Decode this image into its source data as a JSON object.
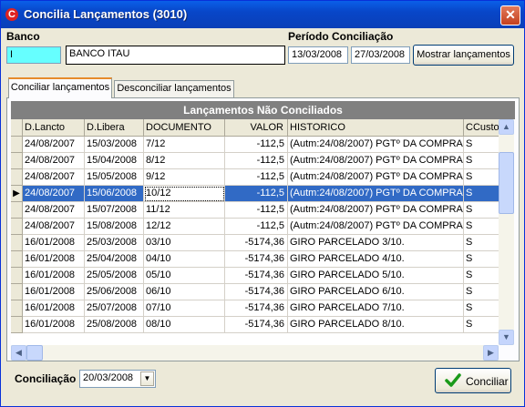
{
  "window": {
    "title": "Concilia Lançamentos (3010)",
    "close": "✕"
  },
  "banco": {
    "label": "Banco",
    "code": "I",
    "name": "BANCO ITAU"
  },
  "periodo": {
    "label": "Período Conciliação",
    "start": "13/03/2008",
    "end": "27/03/2008",
    "button": "Mostrar lançamentos"
  },
  "tabs": [
    "Conciliar lançamentos",
    "Desconciliar lançamentos"
  ],
  "grid": {
    "title": "Lançamentos Não Conciliados",
    "columns": [
      "D.Lancto",
      "D.Libera",
      "DOCUMENTO",
      "VALOR",
      "HISTORICO",
      "CCusto"
    ],
    "selected_row": 3,
    "current_marker": "▶",
    "rows": [
      [
        "24/08/2007",
        "15/03/2008",
        "7/12",
        "-112,5",
        "(Autm:24/08/2007) PGTº DA COMPRA",
        "S"
      ],
      [
        "24/08/2007",
        "15/04/2008",
        "8/12",
        "-112,5",
        "(Autm:24/08/2007) PGTº DA COMPRA",
        "S"
      ],
      [
        "24/08/2007",
        "15/05/2008",
        "9/12",
        "-112,5",
        "(Autm:24/08/2007) PGTº DA COMPRA",
        "S"
      ],
      [
        "24/08/2007",
        "15/06/2008",
        "10/12",
        "-112,5",
        "(Autm:24/08/2007) PGTº DA COMPRA",
        "S"
      ],
      [
        "24/08/2007",
        "15/07/2008",
        "11/12",
        "-112,5",
        "(Autm:24/08/2007) PGTº DA COMPRA",
        "S"
      ],
      [
        "24/08/2007",
        "15/08/2008",
        "12/12",
        "-112,5",
        "(Autm:24/08/2007) PGTº DA COMPRA",
        "S"
      ],
      [
        "16/01/2008",
        "25/03/2008",
        "03/10",
        "-5174,36",
        "GIRO PARCELADO 3/10.",
        "S"
      ],
      [
        "16/01/2008",
        "25/04/2008",
        "04/10",
        "-5174,36",
        "GIRO PARCELADO 4/10.",
        "S"
      ],
      [
        "16/01/2008",
        "25/05/2008",
        "05/10",
        "-5174,36",
        "GIRO PARCELADO 5/10.",
        "S"
      ],
      [
        "16/01/2008",
        "25/06/2008",
        "06/10",
        "-5174,36",
        "GIRO PARCELADO 6/10.",
        "S"
      ],
      [
        "16/01/2008",
        "25/07/2008",
        "07/10",
        "-5174,36",
        "GIRO PARCELADO 7/10.",
        "S"
      ],
      [
        "16/01/2008",
        "25/08/2008",
        "08/10",
        "-5174,36",
        "GIRO PARCELADO 8/10.",
        "S"
      ]
    ]
  },
  "conciliacao": {
    "label": "Conciliação",
    "date": "20/03/2008",
    "button": "Conciliar"
  },
  "icons": {
    "check": "check-icon",
    "app": "app-icon",
    "scroll_up": "▲",
    "scroll_down": "▼",
    "scroll_left": "◀",
    "scroll_right": "▶",
    "dropdown": "▼"
  }
}
